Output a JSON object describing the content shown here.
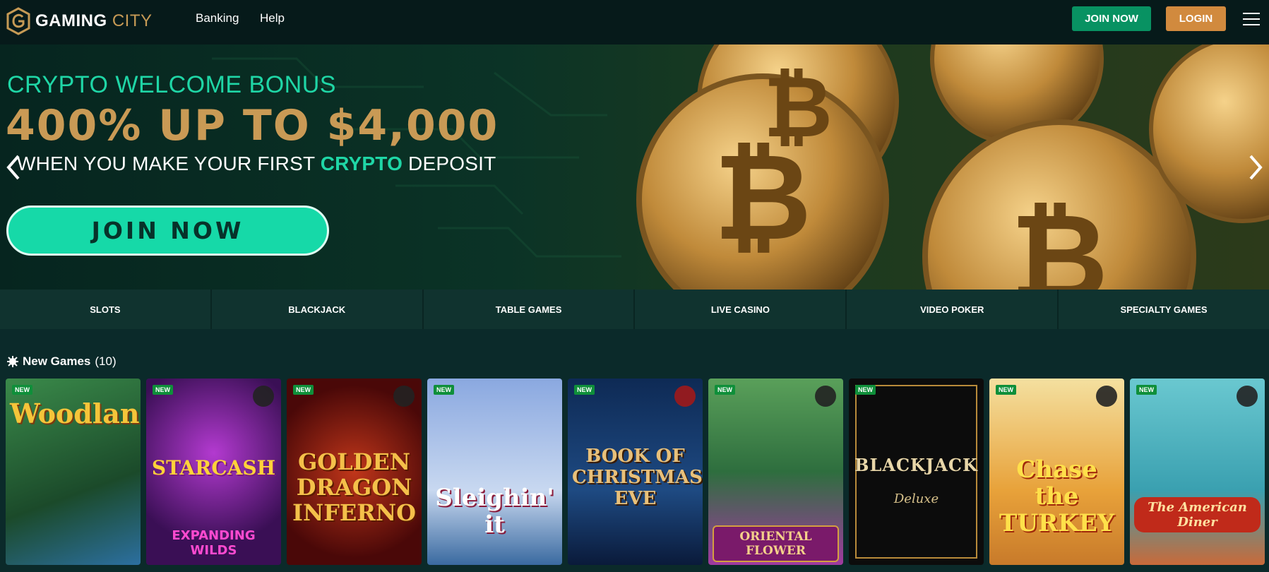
{
  "header": {
    "brand_primary": "GAMING",
    "brand_secondary": "CITY",
    "nav": [
      "Banking",
      "Help"
    ],
    "join_label": "JOIN NOW",
    "login_label": "LOGIN"
  },
  "hero": {
    "title_line1": "CRYPTO WELCOME BONUS",
    "title_line2": "400% UP TO $4,000",
    "sub_prefix": "WHEN YOU MAKE YOUR FIRST ",
    "sub_highlight": "CRYPTO",
    "sub_suffix": " DEPOSIT",
    "cta_label": "JOIN NOW"
  },
  "categories": [
    "SLOTS",
    "BLACKJACK",
    "TABLE GAMES",
    "LIVE CASINO",
    "VIDEO POKER",
    "SPECIALTY GAMES"
  ],
  "new_games": {
    "title": "New Games",
    "count": "(10)",
    "badge": "NEW",
    "tiles": [
      {
        "name": "Woodlanders",
        "bg": "#2d6b3a"
      },
      {
        "name": "STARCASH",
        "subtitle": "EXPANDING WILDS",
        "bg": "#5a1f78"
      },
      {
        "name": "GOLDEN DRAGON INFERNO",
        "bg": "#7a1410"
      },
      {
        "name": "Sleighin' it",
        "bg": "#6d8bc7"
      },
      {
        "name": "BOOK OF CHRISTMAS EVE",
        "bg": "#1c3d6e"
      },
      {
        "name": "ORIENTAL FLOWER",
        "bg": "#3e8a3e"
      },
      {
        "name": "BLACKJACK",
        "subtitle": "Deluxe",
        "bg": "#141414"
      },
      {
        "name": "Chase the TURKEY",
        "bg": "#e4a23a"
      },
      {
        "name": "The American Diner",
        "bg": "#4fb7c2"
      }
    ]
  },
  "colors": {
    "header_bg": "#061a1a",
    "accent_green": "#1fd6a6",
    "gold": "#c99a55",
    "join_btn": "#089262",
    "login_btn": "#d18a3e"
  }
}
